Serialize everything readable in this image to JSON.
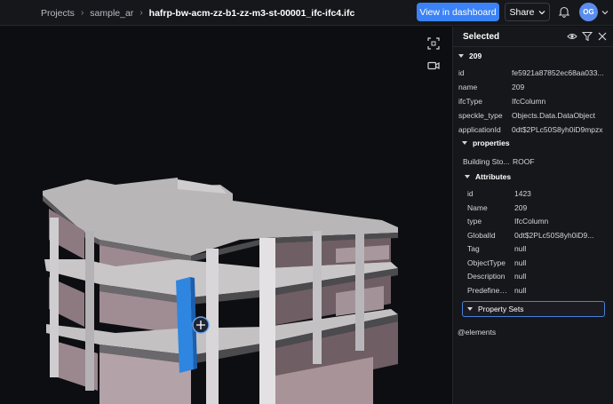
{
  "breadcrumbs": {
    "projects": "Projects",
    "project": "sample_ar",
    "model": "hafrp-bw-acm-zz-b1-zz-m3-st-00001_ifc-ifc4.ifc"
  },
  "header": {
    "dashboard_label": "View in dashboard",
    "share_label": "Share",
    "avatar_initials": "OG"
  },
  "colors": {
    "accent": "#3b82f6",
    "selection": "#2f86e0"
  },
  "panel": {
    "title": "Selected",
    "object_label": "209",
    "fields": [
      {
        "key": "id",
        "value": "fe5921a87852ec68aa033..."
      },
      {
        "key": "name",
        "value": "209"
      },
      {
        "key": "ifcType",
        "value": "IfcColumn"
      },
      {
        "key": "speckle_type",
        "value": "Objects.Data.DataObject"
      },
      {
        "key": "applicationId",
        "value": "0dt$2PLc50S8yh0iD9mpzx"
      }
    ],
    "properties_label": "properties",
    "building_storey": {
      "key": "Building Sto...",
      "value": "ROOF"
    },
    "attributes_label": "Attributes",
    "attributes": [
      {
        "key": "id",
        "value": "1423"
      },
      {
        "key": "Name",
        "value": "209"
      },
      {
        "key": "type",
        "value": "IfcColumn"
      },
      {
        "key": "GlobalId",
        "value": "0dt$2PLc50S8yh0iD9..."
      },
      {
        "key": "Tag",
        "value": "null"
      },
      {
        "key": "ObjectType",
        "value": "null"
      },
      {
        "key": "Description",
        "value": "null"
      },
      {
        "key": "Predefined...",
        "value": "null"
      }
    ],
    "property_sets_label": "Property Sets",
    "elements_label": "@elements"
  },
  "icons": {
    "viewer_tools": [
      "frame-icon",
      "camera-icon"
    ],
    "panel": [
      "eye-icon",
      "filter-icon",
      "close-icon"
    ]
  }
}
